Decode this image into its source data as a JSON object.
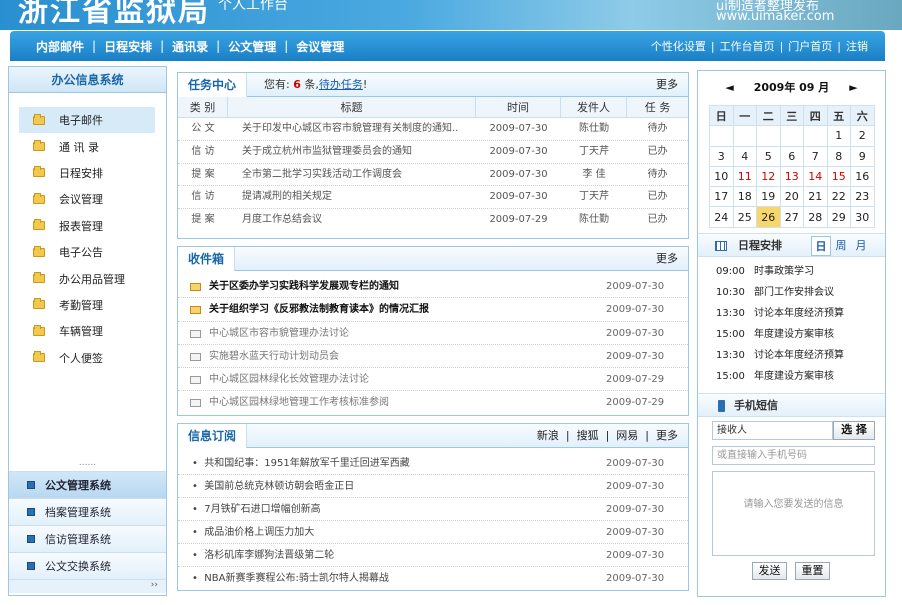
{
  "header": {
    "title": "浙江省监狱局",
    "subtitle": "个人工作台",
    "wm1": "ui制造者整理发布",
    "wm2": "www.uimaker.com"
  },
  "nav": {
    "items": [
      "内部邮件",
      "日程安排",
      "通讯录",
      "公文管理",
      "会议管理"
    ],
    "right": [
      "个性化设置",
      "工作台首页",
      "门户首页",
      "注销"
    ]
  },
  "sidebar": {
    "title": "办公信息系统",
    "items": [
      "电子邮件",
      "通 讯 录",
      "日程安排",
      "会议管理",
      "报表管理",
      "电子公告",
      "办公用品管理",
      "考勤管理",
      "车辆管理",
      "个人便签"
    ],
    "dots": "......",
    "systems": [
      "公文管理系统",
      "档案管理系统",
      "信访管理系统",
      "公文交换系统"
    ],
    "more": "››"
  },
  "tasks": {
    "title": "任务中心",
    "note_pre": "您有:",
    "count": "6",
    "note_mid": "条,",
    "link": "待办任务",
    "note_post": "!",
    "more": "更多",
    "headers": [
      "类 别",
      "标题",
      "时间",
      "发件人",
      "任 务"
    ],
    "rows": [
      [
        "公 文",
        "关于印发中心城区市容市貌管理有关制度的通知..",
        "2009-07-30",
        "陈仕勤",
        "待办"
      ],
      [
        "信 访",
        "关于成立杭州市监狱管理委员会的通知",
        "2009-07-30",
        "丁天芹",
        "已办"
      ],
      [
        "提 案",
        "全市第二批学习实践活动工作调度会",
        "2009-07-30",
        "李  佳",
        "待办"
      ],
      [
        "信 访",
        "提请减刑的相关规定",
        "2009-07-30",
        "丁天芹",
        "已办"
      ],
      [
        "提 案",
        "月度工作总结会议",
        "2009-07-29",
        "陈仕勤",
        "已办"
      ]
    ]
  },
  "inbox": {
    "title": "收件箱",
    "more": "更多",
    "rows": [
      [
        "关于区委办学习实践科学发展观专栏的通知",
        "2009-07-30"
      ],
      [
        "关于组织学习《反邪教法制教育读本》的情况汇报",
        "2009-07-30"
      ],
      [
        "中心城区市容市貌管理办法讨论",
        "2009-07-30"
      ],
      [
        "实施碧水蓝天行动计划动员会",
        "2009-07-30"
      ],
      [
        "中心城区园林绿化长效管理办法讨论",
        "2009-07-29"
      ],
      [
        "中心城区园林绿地管理工作考核标准参阅",
        "2009-07-29"
      ]
    ]
  },
  "feeds": {
    "title": "信息订阅",
    "links": [
      "新浪",
      "搜狐",
      "网易",
      "更多"
    ],
    "rows": [
      [
        "共和国纪事：1951年解放军千里迁回进军西藏",
        "2009-07-30"
      ],
      [
        "美国前总统克林顿访朝会晤金正日",
        "2009-07-30"
      ],
      [
        "7月铁矿石进口增幅创新高",
        "2009-07-30"
      ],
      [
        "成品油价格上调压力加大",
        "2009-07-30"
      ],
      [
        "洛杉矶库李娜狗法晋级第二轮",
        "2009-07-30"
      ],
      [
        "NBA新赛季赛程公布:骑士凯尔特人揭幕战",
        "2009-07-30"
      ]
    ]
  },
  "calendar": {
    "prev": "◄",
    "next": "►",
    "title": "2009年 09 月",
    "weekdays": [
      "日",
      "一",
      "二",
      "三",
      "四",
      "五",
      "六"
    ],
    "weeks": [
      [
        "",
        "",
        "",
        "",
        "",
        "1",
        "2"
      ],
      [
        "3",
        "4",
        "5",
        "6",
        "7",
        "8",
        "9"
      ],
      [
        "10",
        "11",
        "12",
        "13",
        "14",
        "15",
        "16"
      ],
      [
        "17",
        "18",
        "19",
        "20",
        "21",
        "22",
        "23"
      ],
      [
        "24",
        "25",
        "26",
        "27",
        "28",
        "29",
        "30"
      ]
    ],
    "red_days": [
      "11",
      "12",
      "13",
      "14",
      "15"
    ],
    "today": "26"
  },
  "schedule": {
    "title": "日程安排",
    "tabs": [
      "日",
      "周",
      "月"
    ],
    "items": [
      [
        "09:00",
        "时事政策学习"
      ],
      [
        "10:30",
        "部门工作安排会议"
      ],
      [
        "13:30",
        "讨论本年度经济预算"
      ],
      [
        "15:00",
        "年度建设方案审核"
      ],
      [
        "13:30",
        "讨论本年度经济预算"
      ],
      [
        "15:00",
        "年度建设方案审核"
      ]
    ]
  },
  "sms": {
    "title": "手机短信",
    "receiver": "接收人",
    "choose": "选 择",
    "phone_ph": "或直接输入手机号码",
    "msg_ph": "请输入您要发送的信息",
    "send": "发送",
    "reset": "重置"
  }
}
